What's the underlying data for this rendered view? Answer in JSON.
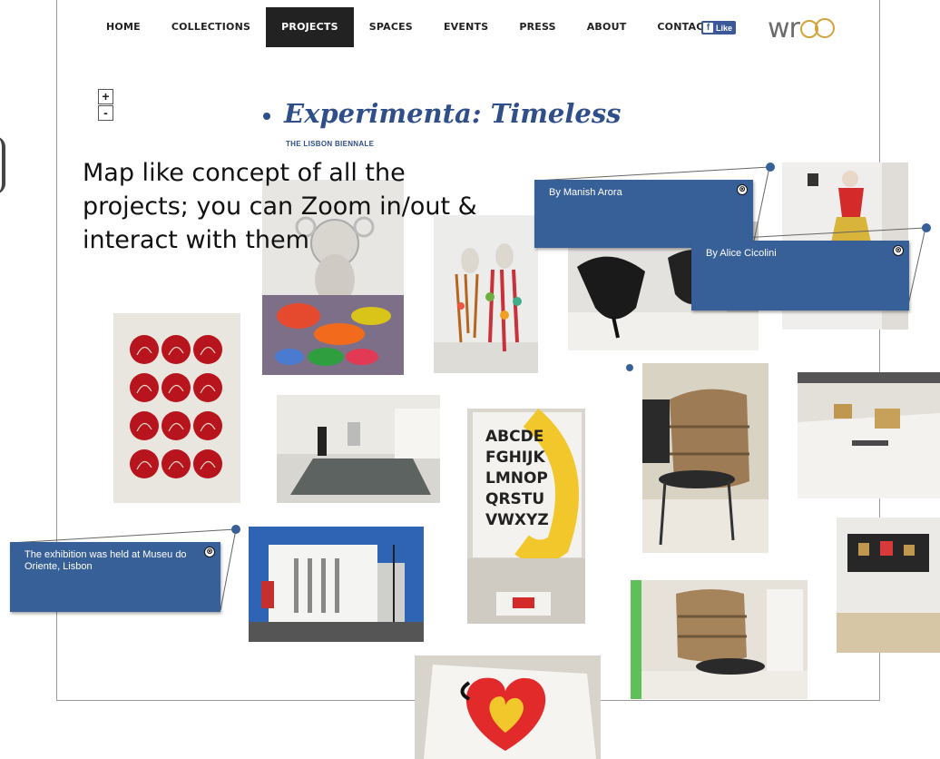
{
  "nav": {
    "items": [
      "HOME",
      "COLLECTIONS",
      "PROJECTS",
      "SPACES",
      "EVENTS",
      "PRESS",
      "ABOUT",
      "CONTACT"
    ],
    "active": "PROJECTS",
    "fb_like": "Like",
    "fb_icon": "f"
  },
  "logo": {
    "text": "wr",
    "accent": "#d4a23a"
  },
  "zoom": {
    "in": "+",
    "out": "-"
  },
  "title": "Experimenta: Timeless",
  "subtitle": "THE LISBON BIENNALE",
  "annotation": "Map like concept of all the projects; you can Zoom in/out & interact with them",
  "popups": {
    "manish": "By Manish Arora",
    "alice": "By Alice Cicolini",
    "museum": "The exhibition was held at Museu do Oriente, Lisbon",
    "close_glyph": "⊗"
  },
  "colors": {
    "title_blue": "#2f4e8a",
    "popup_blue": "#386098",
    "nav_active_bg": "#222222",
    "fb_blue": "#3b5998"
  },
  "icons": {
    "zoom_in": "plus-icon",
    "zoom_out": "minus-icon",
    "close": "close-icon",
    "facebook": "facebook-icon"
  },
  "type_letters": [
    "ABCDE",
    "FGHIJK",
    "LMNOP",
    "QRSTU",
    "VWXYZ"
  ]
}
